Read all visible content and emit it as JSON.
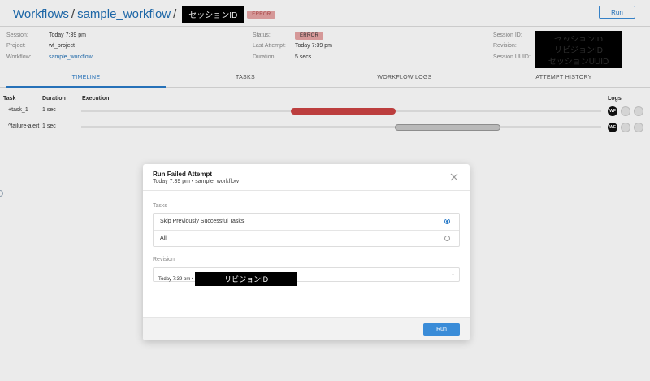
{
  "header": {
    "crumb_workflows": "Workflows",
    "crumb_sep": "/",
    "crumb_workflow": "sample_workflow",
    "crumb_session": "セッションID",
    "status_badge": "ERROR",
    "run_label": "Run"
  },
  "info": {
    "session_label": "Session:",
    "session_value": "Today 7:39 pm",
    "project_label": "Project:",
    "project_value": "wf_project",
    "workflow_label": "Workflow:",
    "workflow_value": "sample_workflow",
    "status_label": "Status:",
    "status_value": "ERROR",
    "last_attempt_label": "Last Attempt:",
    "last_attempt_value": "Today 7:39 pm",
    "duration_label": "Duration:",
    "duration_value": "5 secs",
    "session_id_label": "Session ID:",
    "session_id_value": "セッションID",
    "revision_label": "Revision:",
    "revision_value": "リビジョンID",
    "session_uuid_label": "Session UUID:",
    "session_uuid_value": "セッションUUID"
  },
  "tabs": [
    "TIMELINE",
    "TASKS",
    "WORKFLOW LOGS",
    "ATTEMPT HISTORY"
  ],
  "timeline": {
    "col_task": "Task",
    "col_duration": "Duration",
    "col_execution": "Execution",
    "col_logs": "Logs",
    "rows": [
      {
        "name": "+task_1",
        "duration": "1 sec",
        "log": "WF"
      },
      {
        "name": "^failure-alert",
        "duration": "1 sec",
        "log": "WF"
      }
    ]
  },
  "colors": {
    "accent": "#2a7bc8",
    "error_bar": "#cc4444",
    "neutral_bar": "#c9c9c9"
  },
  "modal": {
    "title": "Run Failed Attempt",
    "subtitle": "Today 7:39 pm • sample_workflow",
    "tasks_label": "Tasks",
    "options": [
      "Skip Previously Successful Tasks",
      "All"
    ],
    "selected_option": "Skip Previously Successful Tasks",
    "revision_label": "Revision",
    "revision_prefix": "Today 7:39 pm •",
    "revision_value": "リビジョンID",
    "run_label": "Run"
  }
}
